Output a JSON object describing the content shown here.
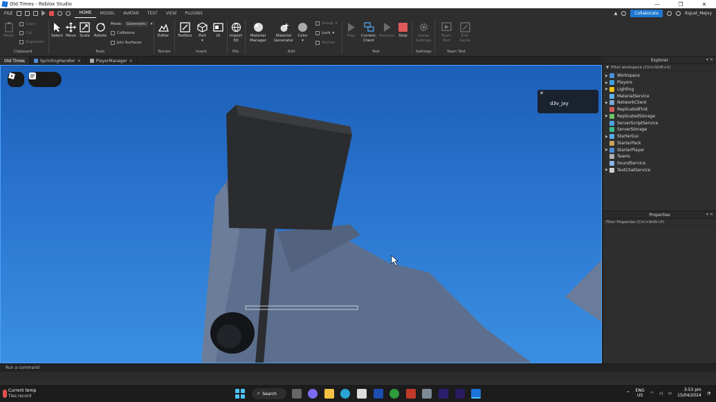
{
  "window": {
    "title": "Old Times - Roblox Studio",
    "controls": [
      "—",
      "❐",
      "✕"
    ]
  },
  "menu": {
    "file": "FILE",
    "tabs": [
      "HOME",
      "MODEL",
      "AVATAR",
      "TEST",
      "VIEW",
      "PLUGINS"
    ],
    "active_tab": "HOME",
    "collaborate": "Collaborate",
    "username": "ItsJust_MeJxy"
  },
  "ribbon": {
    "clipboard": {
      "paste": "Paste",
      "copy": "Copy",
      "cut": "Cut",
      "duplicate": "Duplicate",
      "label": "Clipboard"
    },
    "tools": {
      "select": "Select",
      "move": "Move",
      "scale": "Scale",
      "rotate": "Rotate",
      "mode_label": "Mode:",
      "mode_value": "Geometric",
      "collisions": "Collisions",
      "join_surfaces": "Join Surfaces",
      "label": "Tools"
    },
    "terrain": {
      "editor": "Editor",
      "label": "Terrain"
    },
    "insert": {
      "toolbox": "Toolbox",
      "part": "Part",
      "ui": "UI",
      "label": "Insert"
    },
    "file": {
      "import3d": "Import 3D",
      "label": "File"
    },
    "edit": {
      "material_manager": "Material Manager",
      "material_generator": "Material Generator",
      "color": "Color",
      "group": "Group",
      "lock": "Lock",
      "anchor": "Anchor",
      "label": "Edit"
    },
    "test": {
      "play": "Play",
      "current_client": "Current: Client",
      "resume": "Resume",
      "stop": "Stop",
      "label": "Test"
    },
    "settings": {
      "game_settings": "Game Settings",
      "label": "Settings"
    },
    "team_test": {
      "team_test": "Team Test",
      "exit_game": "Exit Game",
      "label": "Team Test"
    }
  },
  "doc_tabs": [
    {
      "label": "Old Times",
      "active": true
    },
    {
      "label": "SprintingHandler",
      "active": false
    },
    {
      "label": "PlayerManager",
      "active": false
    }
  ],
  "viewport": {
    "notification_name": "d3v_jxy"
  },
  "explorer": {
    "title": "Explorer",
    "filter": "Filter workspace (Ctrl+Shift+X)",
    "items": [
      {
        "label": "Workspace",
        "color": "#4a90d9",
        "expandable": true
      },
      {
        "label": "Players",
        "color": "#3fa0e0",
        "expandable": true
      },
      {
        "label": "Lighting",
        "color": "#f0c419",
        "expandable": true
      },
      {
        "label": "MaterialService",
        "color": "#5fb0e8",
        "expandable": false
      },
      {
        "label": "NetworkClient",
        "color": "#7aa7d6",
        "expandable": true
      },
      {
        "label": "ReplicatedFirst",
        "color": "#d35a5a",
        "expandable": false
      },
      {
        "label": "ReplicatedStorage",
        "color": "#6ec46e",
        "expandable": true
      },
      {
        "label": "ServerScriptService",
        "color": "#4ea2e0",
        "expandable": false
      },
      {
        "label": "ServerStorage",
        "color": "#3dbb8a",
        "expandable": false
      },
      {
        "label": "StarterGui",
        "color": "#5aa9e6",
        "expandable": true
      },
      {
        "label": "StarterPack",
        "color": "#c9a15a",
        "expandable": false
      },
      {
        "label": "StarterPlayer",
        "color": "#4d8fd8",
        "expandable": true
      },
      {
        "label": "Teams",
        "color": "#b0b0b0",
        "expandable": false
      },
      {
        "label": "SoundService",
        "color": "#8ab4e8",
        "expandable": false
      },
      {
        "label": "TextChatService",
        "color": "#d0d0d0",
        "expandable": true
      }
    ]
  },
  "properties": {
    "title": "Properties",
    "filter": "Filter Properties (Ctrl+Shift+P)"
  },
  "command_bar": {
    "placeholder": "Run a command"
  },
  "taskbar": {
    "weather_title": "Current temp",
    "weather_sub": "Ties record",
    "search": "Search",
    "lang_top": "ENG",
    "lang_bottom": "US",
    "time": "3:53 pm",
    "date": "15/04/2024"
  }
}
